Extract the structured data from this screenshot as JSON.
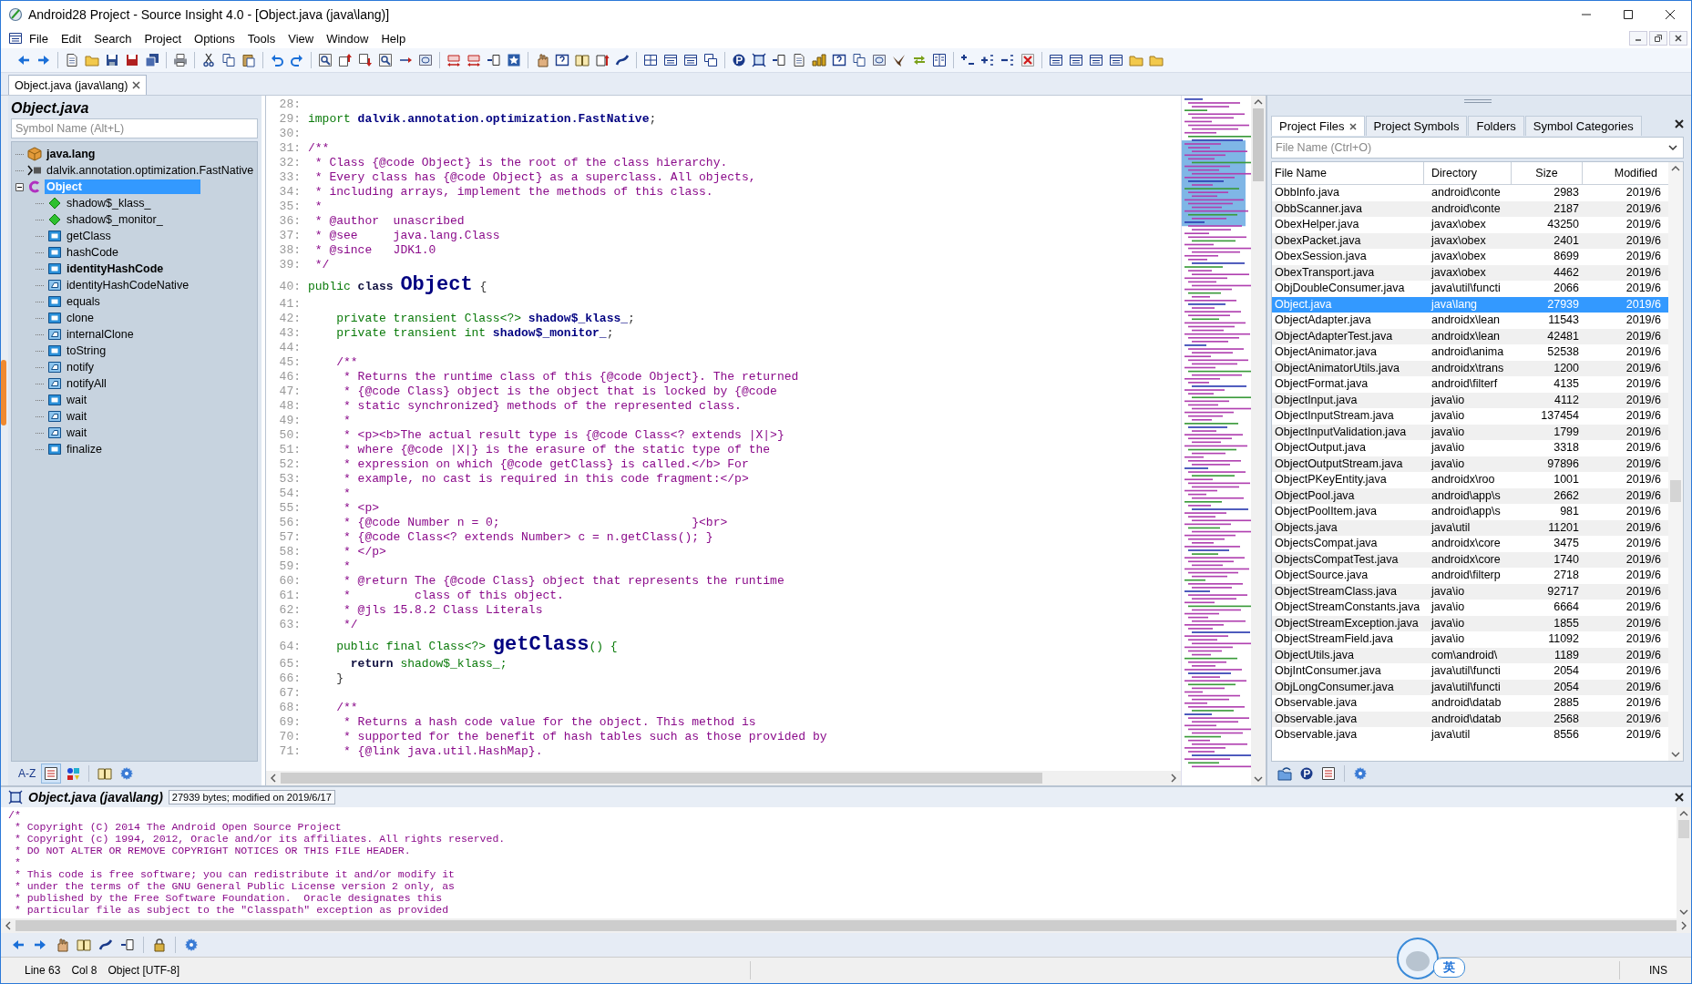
{
  "window": {
    "title": "Android28 Project - Source Insight 4.0 - [Object.java (java\\lang)]"
  },
  "menu": [
    "File",
    "Edit",
    "Search",
    "Project",
    "Options",
    "Tools",
    "View",
    "Window",
    "Help"
  ],
  "editor_tabs": [
    {
      "label": "Object.java (java\\lang)",
      "selected": true
    }
  ],
  "symbol_window": {
    "title": "Object.java",
    "search_placeholder": "Symbol Name (Alt+L)",
    "sort_button": "A-Z",
    "tree": [
      {
        "label": "java.lang",
        "kind": "package",
        "bold": true,
        "selected": false
      },
      {
        "label": "dalvik.annotation.optimization.FastNative",
        "kind": "import",
        "bold": false,
        "selected": false
      },
      {
        "label": "Object",
        "kind": "class",
        "bold": true,
        "selected": true,
        "expanded": true,
        "children": [
          {
            "label": "shadow$_klass_",
            "kind": "field",
            "bold": false,
            "selected": false
          },
          {
            "label": "shadow$_monitor_",
            "kind": "field",
            "bold": false,
            "selected": false
          },
          {
            "label": "getClass",
            "kind": "method",
            "bold": false,
            "selected": false
          },
          {
            "label": "hashCode",
            "kind": "method",
            "bold": false,
            "selected": false
          },
          {
            "label": "identityHashCode",
            "kind": "method",
            "bold": true,
            "selected": false
          },
          {
            "label": "identityHashCodeNative",
            "kind": "native",
            "bold": false,
            "selected": false
          },
          {
            "label": "equals",
            "kind": "method",
            "bold": false,
            "selected": false
          },
          {
            "label": "clone",
            "kind": "method",
            "bold": false,
            "selected": false
          },
          {
            "label": "internalClone",
            "kind": "native",
            "bold": false,
            "selected": false
          },
          {
            "label": "toString",
            "kind": "method",
            "bold": false,
            "selected": false
          },
          {
            "label": "notify",
            "kind": "native",
            "bold": false,
            "selected": false
          },
          {
            "label": "notifyAll",
            "kind": "native",
            "bold": false,
            "selected": false
          },
          {
            "label": "wait",
            "kind": "method",
            "bold": false,
            "selected": false
          },
          {
            "label": "wait",
            "kind": "native",
            "bold": false,
            "selected": false
          },
          {
            "label": "wait",
            "kind": "native",
            "bold": false,
            "selected": false
          },
          {
            "label": "finalize",
            "kind": "method",
            "bold": false,
            "selected": false
          }
        ]
      }
    ]
  },
  "editor": {
    "lines": [
      {
        "num": "28:"
      },
      {
        "num": "29:",
        "tokens": [
          {
            "text": "import ",
            "kind": "keyword"
          },
          {
            "text": "dalvik.annotation.optimization.FastNative",
            "kind": "decl"
          },
          {
            "text": ";",
            "kind": "plain"
          }
        ]
      },
      {
        "num": "30:"
      },
      {
        "num": "31:",
        "tokens": [
          {
            "text": "/**",
            "kind": "comment"
          }
        ]
      },
      {
        "num": "32:",
        "tokens": [
          {
            "text": " * Class {@code Object} is the root of the class hierarchy.",
            "kind": "comment"
          }
        ]
      },
      {
        "num": "33:",
        "tokens": [
          {
            "text": " * Every class has {@code Object} as a superclass. All objects,",
            "kind": "comment"
          }
        ]
      },
      {
        "num": "34:",
        "tokens": [
          {
            "text": " * including arrays, implement the methods of this class.",
            "kind": "comment"
          }
        ]
      },
      {
        "num": "35:",
        "tokens": [
          {
            "text": " *",
            "kind": "comment"
          }
        ]
      },
      {
        "num": "36:",
        "tokens": [
          {
            "text": " * @author  unascribed",
            "kind": "comment"
          }
        ]
      },
      {
        "num": "37:",
        "tokens": [
          {
            "text": " * @see     java.lang.Class",
            "kind": "comment"
          }
        ]
      },
      {
        "num": "38:",
        "tokens": [
          {
            "text": " * @since   JDK1.0",
            "kind": "comment"
          }
        ]
      },
      {
        "num": "39:",
        "tokens": [
          {
            "text": " */",
            "kind": "comment"
          }
        ]
      },
      {
        "num": "40:",
        "tokens": [
          {
            "text": "public ",
            "kind": "keyword"
          },
          {
            "text": "class ",
            "kind": "keyword-bold"
          },
          {
            "text": "Object",
            "kind": "big"
          },
          {
            "text": " {",
            "kind": "plain"
          }
        ]
      },
      {
        "num": "41:"
      },
      {
        "num": "42:",
        "tokens": [
          {
            "text": "    private transient Class<?> ",
            "kind": "keyword"
          },
          {
            "text": "shadow$_klass_",
            "kind": "decl"
          },
          {
            "text": ";",
            "kind": "plain"
          }
        ]
      },
      {
        "num": "43:",
        "tokens": [
          {
            "text": "    private transient int ",
            "kind": "keyword"
          },
          {
            "text": "shadow$_monitor_",
            "kind": "decl"
          },
          {
            "text": ";",
            "kind": "plain"
          }
        ]
      },
      {
        "num": "44:"
      },
      {
        "num": "45:",
        "tokens": [
          {
            "text": "    /**",
            "kind": "comment"
          }
        ]
      },
      {
        "num": "46:",
        "tokens": [
          {
            "text": "     * Returns the runtime class of this {@code Object}. The returned",
            "kind": "comment"
          }
        ]
      },
      {
        "num": "47:",
        "tokens": [
          {
            "text": "     * {@code Class} object is the object that is locked by {@code",
            "kind": "comment"
          }
        ]
      },
      {
        "num": "48:",
        "tokens": [
          {
            "text": "     * static synchronized} methods of the represented class.",
            "kind": "comment"
          }
        ]
      },
      {
        "num": "49:",
        "tokens": [
          {
            "text": "     *",
            "kind": "comment"
          }
        ]
      },
      {
        "num": "50:",
        "tokens": [
          {
            "text": "     * <p><b>The actual result type is {@code Class<? extends |X|>}",
            "kind": "comment"
          }
        ]
      },
      {
        "num": "51:",
        "tokens": [
          {
            "text": "     * where {@code |X|} is the erasure of the static type of the",
            "kind": "comment"
          }
        ]
      },
      {
        "num": "52:",
        "tokens": [
          {
            "text": "     * expression on which {@code getClass} is called.</b> For",
            "kind": "comment"
          }
        ]
      },
      {
        "num": "53:",
        "tokens": [
          {
            "text": "     * example, no cast is required in this code fragment:</p>",
            "kind": "comment"
          }
        ]
      },
      {
        "num": "54:",
        "tokens": [
          {
            "text": "     *",
            "kind": "comment"
          }
        ]
      },
      {
        "num": "55:",
        "tokens": [
          {
            "text": "     * <p>",
            "kind": "comment"
          }
        ]
      },
      {
        "num": "56:",
        "tokens": [
          {
            "text": "     * {@code Number n = 0;                           }<br>",
            "kind": "comment"
          }
        ]
      },
      {
        "num": "57:",
        "tokens": [
          {
            "text": "     * {@code Class<? extends Number> c = n.getClass(); }",
            "kind": "comment"
          }
        ]
      },
      {
        "num": "58:",
        "tokens": [
          {
            "text": "     * </p>",
            "kind": "comment"
          }
        ]
      },
      {
        "num": "59:",
        "tokens": [
          {
            "text": "     *",
            "kind": "comment"
          }
        ]
      },
      {
        "num": "60:",
        "tokens": [
          {
            "text": "     * @return The {@code Class} object that represents the runtime",
            "kind": "comment"
          }
        ]
      },
      {
        "num": "61:",
        "tokens": [
          {
            "text": "     *         class of this object.",
            "kind": "comment"
          }
        ]
      },
      {
        "num": "62:",
        "tokens": [
          {
            "text": "     * @jls 15.8.2 Class Literals",
            "kind": "comment"
          }
        ]
      },
      {
        "num": "63:",
        "tokens": [
          {
            "text": "     */",
            "kind": "comment"
          }
        ]
      },
      {
        "num": "64:",
        "tokens": [
          {
            "text": "    public final Class<?> ",
            "kind": "keyword"
          },
          {
            "text": "getClass",
            "kind": "big"
          },
          {
            "text": "() {",
            "kind": "keyword"
          }
        ]
      },
      {
        "num": "65:",
        "tokens": [
          {
            "text": "      return",
            "kind": "keyword-bold"
          },
          {
            "text": " shadow$_klass_;",
            "kind": "keyword"
          }
        ]
      },
      {
        "num": "66:",
        "tokens": [
          {
            "text": "    }",
            "kind": "plain"
          }
        ]
      },
      {
        "num": "67:"
      },
      {
        "num": "68:",
        "tokens": [
          {
            "text": "    /**",
            "kind": "comment"
          }
        ]
      },
      {
        "num": "69:",
        "tokens": [
          {
            "text": "     * Returns a hash code value for the object. This method is",
            "kind": "comment"
          }
        ]
      },
      {
        "num": "70:",
        "tokens": [
          {
            "text": "     * supported for the benefit of hash tables such as those provided by",
            "kind": "comment"
          }
        ]
      },
      {
        "num": "71:",
        "tokens": [
          {
            "text": "     * {@link java.util.HashMap}.",
            "kind": "comment"
          }
        ]
      }
    ]
  },
  "project_window": {
    "tabs": [
      {
        "label": "Project Files",
        "selected": true,
        "closable": true
      },
      {
        "label": "Project Symbols",
        "selected": false,
        "closable": false
      },
      {
        "label": "Folders",
        "selected": false,
        "closable": false
      },
      {
        "label": "Symbol Categories",
        "selected": false,
        "closable": false
      }
    ],
    "search_placeholder": "File Name (Ctrl+O)",
    "columns": [
      "File Name",
      "Directory",
      "Size",
      "Modified"
    ],
    "rows": [
      {
        "file_name": "ObbInfo.java",
        "directory": "android\\conte",
        "size": "2983",
        "modified": "2019/6",
        "selected": false
      },
      {
        "file_name": "ObbScanner.java",
        "directory": "android\\conte",
        "size": "2187",
        "modified": "2019/6",
        "selected": false
      },
      {
        "file_name": "ObexHelper.java",
        "directory": "javax\\obex",
        "size": "43250",
        "modified": "2019/6",
        "selected": false
      },
      {
        "file_name": "ObexPacket.java",
        "directory": "javax\\obex",
        "size": "2401",
        "modified": "2019/6",
        "selected": false
      },
      {
        "file_name": "ObexSession.java",
        "directory": "javax\\obex",
        "size": "8699",
        "modified": "2019/6",
        "selected": false
      },
      {
        "file_name": "ObexTransport.java",
        "directory": "javax\\obex",
        "size": "4462",
        "modified": "2019/6",
        "selected": false
      },
      {
        "file_name": "ObjDoubleConsumer.java",
        "directory": "java\\util\\functi",
        "size": "2066",
        "modified": "2019/6",
        "selected": false
      },
      {
        "file_name": "Object.java",
        "directory": "java\\lang",
        "size": "27939",
        "modified": "2019/6",
        "selected": true
      },
      {
        "file_name": "ObjectAdapter.java",
        "directory": "androidx\\lean",
        "size": "11543",
        "modified": "2019/6",
        "selected": false
      },
      {
        "file_name": "ObjectAdapterTest.java",
        "directory": "androidx\\lean",
        "size": "42481",
        "modified": "2019/6",
        "selected": false
      },
      {
        "file_name": "ObjectAnimator.java",
        "directory": "android\\anima",
        "size": "52538",
        "modified": "2019/6",
        "selected": false
      },
      {
        "file_name": "ObjectAnimatorUtils.java",
        "directory": "androidx\\trans",
        "size": "1200",
        "modified": "2019/6",
        "selected": false
      },
      {
        "file_name": "ObjectFormat.java",
        "directory": "android\\filterf",
        "size": "4135",
        "modified": "2019/6",
        "selected": false
      },
      {
        "file_name": "ObjectInput.java",
        "directory": "java\\io",
        "size": "4112",
        "modified": "2019/6",
        "selected": false
      },
      {
        "file_name": "ObjectInputStream.java",
        "directory": "java\\io",
        "size": "137454",
        "modified": "2019/6",
        "selected": false
      },
      {
        "file_name": "ObjectInputValidation.java",
        "directory": "java\\io",
        "size": "1799",
        "modified": "2019/6",
        "selected": false
      },
      {
        "file_name": "ObjectOutput.java",
        "directory": "java\\io",
        "size": "3318",
        "modified": "2019/6",
        "selected": false
      },
      {
        "file_name": "ObjectOutputStream.java",
        "directory": "java\\io",
        "size": "97896",
        "modified": "2019/6",
        "selected": false
      },
      {
        "file_name": "ObjectPKeyEntity.java",
        "directory": "androidx\\roo",
        "size": "1001",
        "modified": "2019/6",
        "selected": false
      },
      {
        "file_name": "ObjectPool.java",
        "directory": "android\\app\\s",
        "size": "2662",
        "modified": "2019/6",
        "selected": false
      },
      {
        "file_name": "ObjectPoolItem.java",
        "directory": "android\\app\\s",
        "size": "981",
        "modified": "2019/6",
        "selected": false
      },
      {
        "file_name": "Objects.java",
        "directory": "java\\util",
        "size": "11201",
        "modified": "2019/6",
        "selected": false
      },
      {
        "file_name": "ObjectsCompat.java",
        "directory": "androidx\\core",
        "size": "3475",
        "modified": "2019/6",
        "selected": false
      },
      {
        "file_name": "ObjectsCompatTest.java",
        "directory": "androidx\\core",
        "size": "1740",
        "modified": "2019/6",
        "selected": false
      },
      {
        "file_name": "ObjectSource.java",
        "directory": "android\\filterp",
        "size": "2718",
        "modified": "2019/6",
        "selected": false
      },
      {
        "file_name": "ObjectStreamClass.java",
        "directory": "java\\io",
        "size": "92717",
        "modified": "2019/6",
        "selected": false
      },
      {
        "file_name": "ObjectStreamConstants.java",
        "directory": "java\\io",
        "size": "6664",
        "modified": "2019/6",
        "selected": false
      },
      {
        "file_name": "ObjectStreamException.java",
        "directory": "java\\io",
        "size": "1855",
        "modified": "2019/6",
        "selected": false
      },
      {
        "file_name": "ObjectStreamField.java",
        "directory": "java\\io",
        "size": "11092",
        "modified": "2019/6",
        "selected": false
      },
      {
        "file_name": "ObjectUtils.java",
        "directory": "com\\android\\",
        "size": "1189",
        "modified": "2019/6",
        "selected": false
      },
      {
        "file_name": "ObjIntConsumer.java",
        "directory": "java\\util\\functi",
        "size": "2054",
        "modified": "2019/6",
        "selected": false
      },
      {
        "file_name": "ObjLongConsumer.java",
        "directory": "java\\util\\functi",
        "size": "2054",
        "modified": "2019/6",
        "selected": false
      },
      {
        "file_name": "Observable.java",
        "directory": "android\\datab",
        "size": "2885",
        "modified": "2019/6",
        "selected": false
      },
      {
        "file_name": "Observable.java",
        "directory": "android\\datab",
        "size": "2568",
        "modified": "2019/6",
        "selected": false
      },
      {
        "file_name": "Observable.java",
        "directory": "java\\util",
        "size": "8556",
        "modified": "2019/6",
        "selected": false
      }
    ]
  },
  "context_window": {
    "title": "Object.java (java\\lang)",
    "info": "27939 bytes; modified on 2019/6/17",
    "lines": [
      "/*",
      " * Copyright (C) 2014 The Android Open Source Project",
      " * Copyright (c) 1994, 2012, Oracle and/or its affiliates. All rights reserved.",
      " * DO NOT ALTER OR REMOVE COPYRIGHT NOTICES OR THIS FILE HEADER.",
      " *",
      " * This code is free software; you can redistribute it and/or modify it",
      " * under the terms of the GNU General Public License version 2 only, as",
      " * published by the Free Software Foundation.  Oracle designates this",
      " * particular file as subject to the \"Classpath\" exception as provided"
    ]
  },
  "ime_indicator": {
    "label": "英"
  },
  "status_bar": {
    "line": "Line 63",
    "col": "Col 8",
    "symbol": "Object [UTF-8]",
    "mode": "INS"
  }
}
